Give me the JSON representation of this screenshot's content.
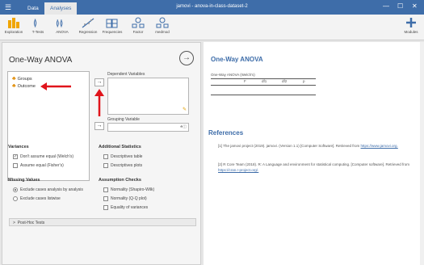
{
  "titlebar": {
    "menu_icon": "☰",
    "tab_data": "Data",
    "tab_analyses": "Analyses",
    "window_title": "jamovi - anova-in-class-dataset-2",
    "minimize": "—",
    "maximize": "☐",
    "close": "✕"
  },
  "ribbon": {
    "exploration": "Exploration",
    "ttests": "T-Tests",
    "anova": "ANOVA",
    "regression": "Regression",
    "frequencies": "Frequencies",
    "factor": "Factor",
    "medmod": "medmod",
    "modules": "Modules"
  },
  "panel": {
    "title": "One-Way ANOVA",
    "variables": [
      "Groups",
      "Outcome"
    ],
    "dependent_label": "Dependent Variables",
    "grouping_label": "Grouping Variable",
    "variances": {
      "title": "Variances",
      "welch": "Don't assume equal (Welch's)",
      "fisher": "Assume equal (Fisher's)"
    },
    "additional": {
      "title": "Additional Statistics",
      "descriptives_table": "Descriptives table",
      "descriptives_plots": "Descriptives plots"
    },
    "missing": {
      "title": "Missing Values",
      "by_analysis": "Exclude cases analysis by analysis",
      "listwise": "Exclude cases listwise"
    },
    "assumptions": {
      "title": "Assumption Checks",
      "normality_sw": "Normality (Shapiro-Wilk)",
      "normality_qq": "Normality (Q-Q plot)",
      "equality": "Equality of variances"
    },
    "posthoc": "Post-Hoc Tests"
  },
  "results": {
    "title": "One-Way ANOVA",
    "table_title": "One-Way ANOVA (Welch's)",
    "columns": [
      "F",
      "df1",
      "df2",
      "p"
    ]
  },
  "references": {
    "title": "References",
    "items": [
      {
        "num": "[1]",
        "text": "The jamovi project (2019). jamovi. (Version 1.1) [Computer Software]. Retrieved from",
        "link": "https://www.jamovi.org."
      },
      {
        "num": "[2]",
        "text": "R Core Team (2018). R: A Language and environment for statistical computing. [Computer software]. Retrieved from",
        "link": "https://cran.r-project.org/."
      }
    ]
  },
  "colors": {
    "brand": "#3e6da9",
    "annotation_arrow": "#e0141b"
  }
}
